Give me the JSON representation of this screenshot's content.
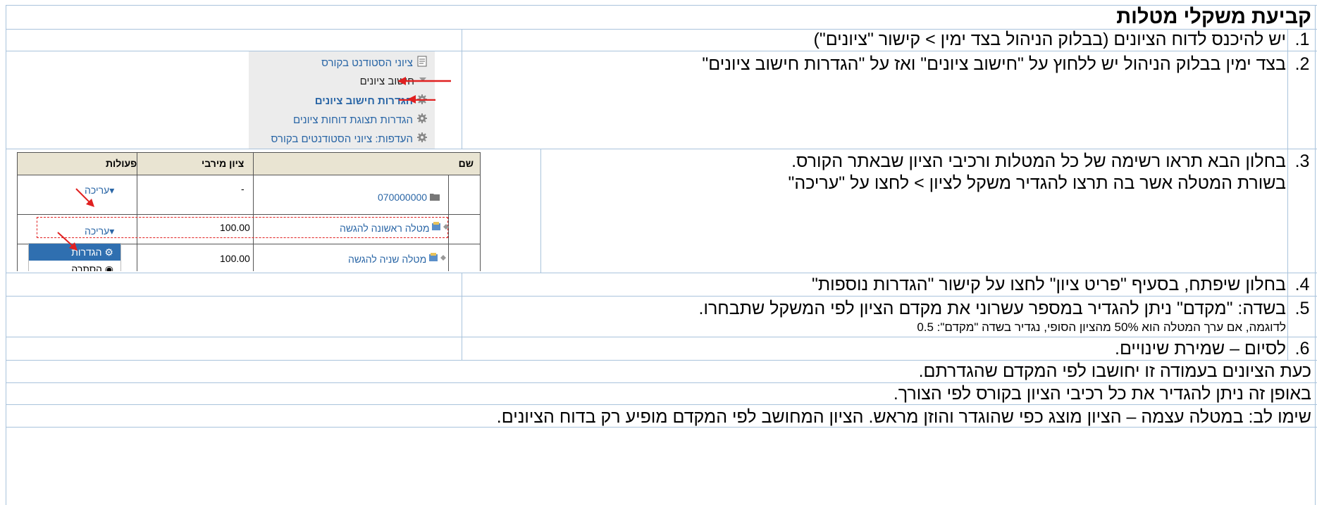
{
  "title": "קביעת משקלי מטלות",
  "steps": [
    {
      "num": ".1",
      "text": "יש להיכנס לדוח הציונים (בבלוק הניהול בצד ימין > קישור \"ציונים\")"
    },
    {
      "num": ".2",
      "text": "בצד ימין בבלוק הניהול יש ללחוץ על \"חישוב ציונים\" ואז על \"הגדרות חישוב ציונים\""
    },
    {
      "num": ".3",
      "line1": "בחלון הבא תראו רשימה של כל המטלות ורכיבי הציון שבאתר הקורס.",
      "line2": "בשורת המטלה אשר בה תרצו להגדיר משקל לציון > לחצו על \"עריכה\""
    },
    {
      "num": ".4",
      "text": "בחלון שיפתח, בסעיף \"פריט ציון\" לחצו על קישור \"הגדרות נוספות\""
    },
    {
      "num": ".5",
      "line1": "בשדה: \"מקדם\" ניתן להגדיר במספר עשרוני את מקדם הציון לפי המשקל שתבחרו.",
      "line2": "לדוגמה, אם ערך המטלה הוא 50% מהציון הסופי, נגדיר בשדה \"מקדם\": 0.5"
    },
    {
      "num": ".6",
      "text": "לסיום – שמירת שינויים."
    }
  ],
  "notes": [
    "כעת הציונים בעמודה זו יחושבו לפי המקדם שהגדרתם.",
    "באופן זה ניתן להגדיר את כל רכיבי הציון בקורס לפי הצורך.",
    "שימו לב: במטלה עצמה – הציון מוצג כפי שהוגדר והוזן מראש. הציון המחושב לפי המקדם מופיע רק בדוח הציונים."
  ],
  "nav_block": {
    "items": [
      {
        "label": "ציוני הסטודנט בקורס",
        "icon": "report-icon"
      },
      {
        "label": "חישוב ציונים",
        "icon": "triangle-down-icon"
      },
      {
        "label": "הגדרות חישוב ציונים",
        "icon": "gear-icon"
      },
      {
        "label": "הגדרות תצוגת דוחות ציונים",
        "icon": "gear-icon"
      },
      {
        "label": "העדפות: ציוני הסטודנטים בקורס",
        "icon": "gear-icon"
      }
    ]
  },
  "gradebook": {
    "headers": {
      "name": "שם",
      "max_grade": "ציון מירבי",
      "actions": "פעולות"
    },
    "rows": [
      {
        "name": "070000000",
        "max": "-",
        "action": "עריכה"
      },
      {
        "name": "מטלה ראשונה להגשה",
        "max": "100.00",
        "action": "עריכה"
      },
      {
        "name": "מטלה שניה להגשה",
        "max": "100.00",
        "action": ""
      }
    ],
    "menu": {
      "settings": "הגדרות",
      "hide": "הסתרה"
    }
  },
  "colors": {
    "border": "#a9c3dc",
    "link": "#2a66a6",
    "arrow": "#e02020",
    "menu_bg": "#2f6fb0"
  }
}
